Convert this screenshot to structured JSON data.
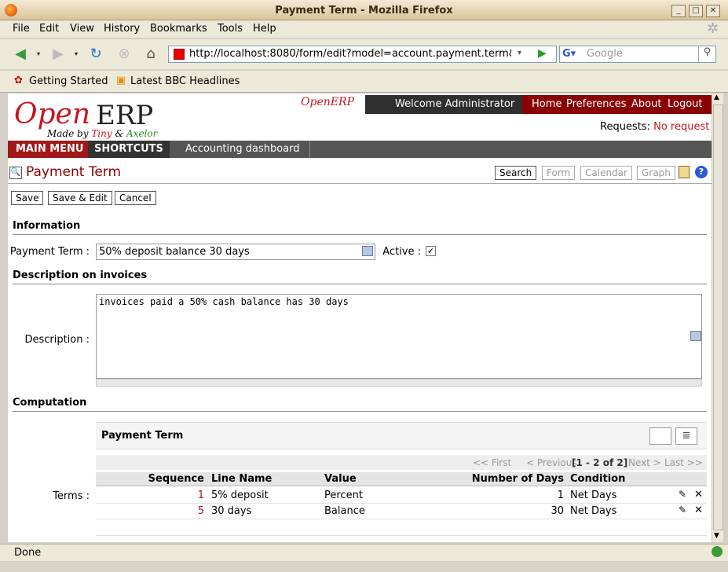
{
  "window": {
    "title": "Payment Term - Mozilla Firefox"
  },
  "menu": [
    "File",
    "Edit",
    "View",
    "History",
    "Bookmarks",
    "Tools",
    "Help"
  ],
  "url": "http://localhost:8080/form/edit?model=account.payment.term&id",
  "search_placeholder": "Google",
  "bookmarks": [
    "Getting Started",
    "Latest BBC Headlines"
  ],
  "header": {
    "logo_open": "Open",
    "logo_erp": "ERP",
    "made_by": "Made by",
    "tiny": "Tiny",
    "amp": "&",
    "axelor": "Axelor",
    "small_logo": "OpenERP",
    "welcome": "Welcome Administrator",
    "links": [
      "Home",
      "Preferences",
      "About",
      "Logout"
    ],
    "requests_label": "Requests:",
    "requests_value": "No request"
  },
  "nav": {
    "main_menu": "MAIN MENU",
    "shortcuts": "SHORTCUTS",
    "dashboard": "Accounting dashboard"
  },
  "page_title": "Payment Term",
  "view_buttons": [
    "Search",
    "Form",
    "Calendar",
    "Graph"
  ],
  "actions": [
    "Save",
    "Save & Edit",
    "Cancel"
  ],
  "sections": {
    "information": "Information",
    "description": "Description on invoices",
    "computation": "Computation"
  },
  "form": {
    "payment_term_label": "Payment Term :",
    "payment_term_value": "50% deposit balance 30 days",
    "active_label": "Active :",
    "active_mark": "✓",
    "description_label": "Description :",
    "description_value": "invoices paid a 50% cash balance has 30 days",
    "terms_label": "Terms :"
  },
  "terms": {
    "title": "Payment Term",
    "pager": {
      "first": "<< First",
      "previous": "< Previous",
      "range": "[1 - 2 of 2]",
      "next": "Next >",
      "last": "Last >>"
    },
    "columns": [
      "Sequence",
      "Line Name",
      "Value",
      "Number of Days",
      "Condition"
    ],
    "rows": [
      {
        "sequence": "1",
        "name": "5% deposit",
        "value": "Percent",
        "days": "1",
        "condition": "Net Days"
      },
      {
        "sequence": "5",
        "name": "30 days",
        "value": "Balance",
        "days": "30",
        "condition": "Net Days"
      }
    ]
  },
  "status": "Done",
  "colors": {
    "accent": "#c4161c",
    "dark_red": "#8a0000",
    "nav_gray": "#555555"
  }
}
